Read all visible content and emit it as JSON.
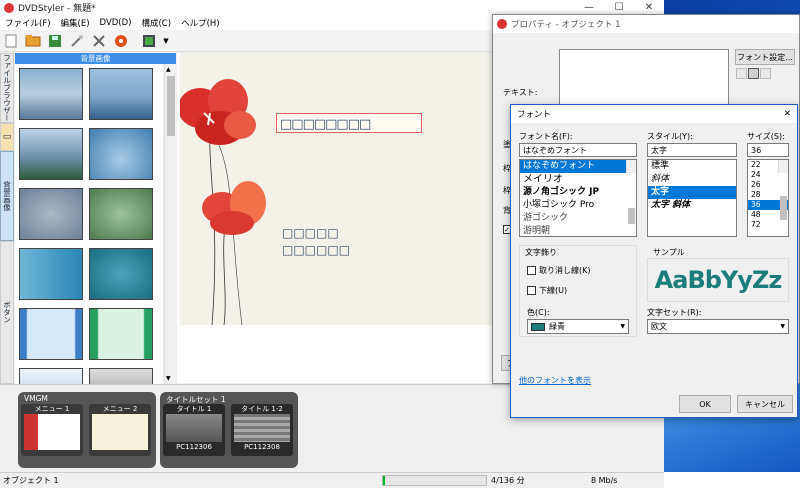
{
  "window": {
    "title": "DVDStyler - 無題*",
    "minimize": "—",
    "maximize": "☐",
    "close": "✕"
  },
  "menu": [
    "ファイル(F)",
    "編集(E)",
    "DVD(D)",
    "構成(C)",
    "ヘルプ(H)"
  ],
  "side_tabs": {
    "file_browser": "ファイルブラウザー",
    "background": "背景画像",
    "buttons": "ボタン"
  },
  "background_header": "背景画像",
  "canvas": {
    "placeholder_title": "□□□□□□□□",
    "placeholder_line1": "□□□□□",
    "placeholder_line2": "□□□□□□"
  },
  "bottom_panel": {
    "vmgm_label": "VMGM",
    "menus": [
      "メニュー 1",
      "メニュー 2"
    ],
    "titleset_label": "タイトルセット 1",
    "titles": [
      {
        "name": "タイトル 1",
        "file": "PC112306"
      },
      {
        "name": "タイトル 1-2",
        "file": "PC112308"
      }
    ]
  },
  "status": {
    "object": "オブジェクト 1",
    "size": "4/136 分",
    "rate": "8 Mb/s"
  },
  "properties": {
    "title": "プロパティ - オブジェクト 1",
    "text_label": "テキスト:",
    "font_settings_button": "フォント設定..."
  },
  "font_dialog": {
    "title": "フォント",
    "close": "✕",
    "font_name_label": "フォント名(F):",
    "font_name_value": "はなぞめフォント",
    "fonts": [
      "はなぞめフォント",
      "メイリオ",
      "源ノ角ゴシック JP",
      "小塚ゴシック Pro",
      "游ゴシック",
      "游明朝"
    ],
    "style_label": "スタイル(Y):",
    "style_value": "太字",
    "styles": [
      "標準",
      "斜体",
      "太字",
      "太字 斜体"
    ],
    "size_label": "サイズ(S):",
    "size_value": "36",
    "sizes": [
      "22",
      "24",
      "26",
      "28",
      "36",
      "48",
      "72"
    ],
    "effects_label": "文字飾り",
    "strikeout_label": "取り消し線(K)",
    "underline_label": "下線(U)",
    "color_label": "色(C):",
    "color_value": "緑青",
    "color_hex": "#1b7e7c",
    "sample_label": "サンプル",
    "sample_text": "AaBbYyZz",
    "charset_label": "文字セット(R):",
    "charset_value": "欧文",
    "more_fonts_link": "他のフォントを表示",
    "ok_button": "OK",
    "cancel_button": "キャンセル"
  }
}
